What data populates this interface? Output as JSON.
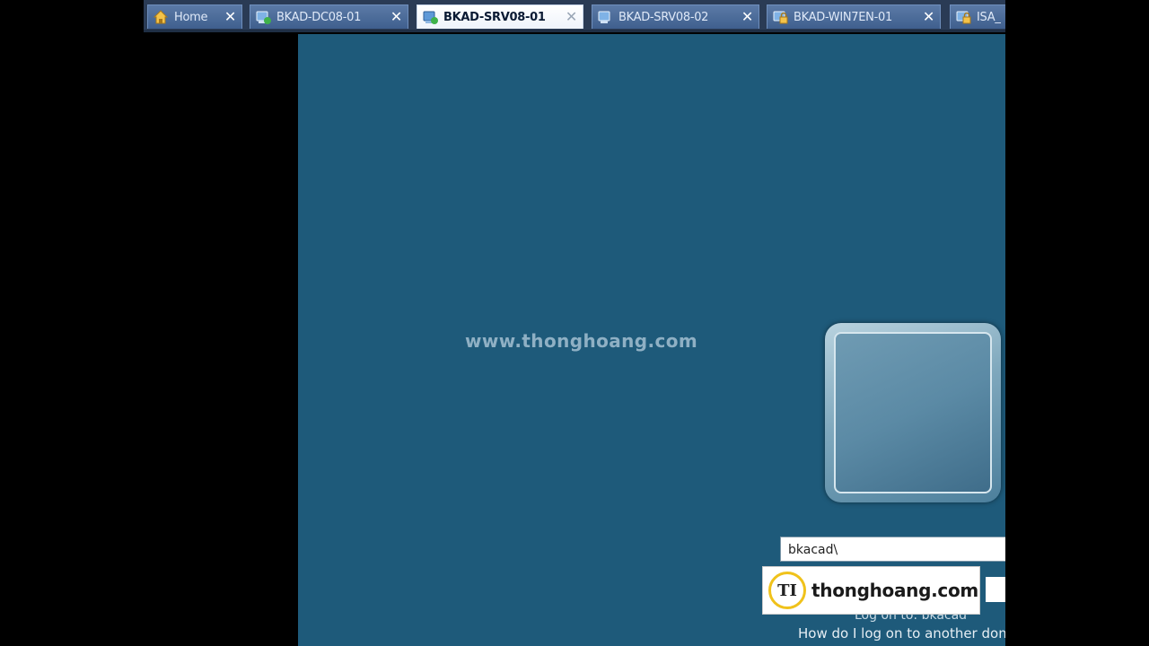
{
  "tabs": [
    {
      "label": "Home",
      "icon": "home-icon",
      "active": false
    },
    {
      "label": "BKAD-DC08-01",
      "icon": "vm-running-icon",
      "active": false
    },
    {
      "label": "BKAD-SRV08-01",
      "icon": "vm-running-icon",
      "active": true
    },
    {
      "label": "BKAD-SRV08-02",
      "icon": "vm-icon",
      "active": false
    },
    {
      "label": "BKAD-WIN7EN-01",
      "icon": "vm-locked-icon",
      "active": false
    },
    {
      "label": "ISA_",
      "icon": "vm-locked-icon",
      "active": false
    }
  ],
  "close_glyph": "✕",
  "console": {
    "watermark": "www.thonghoang.com",
    "username_value": "bkacad\\",
    "logon_to_text": "Log on to: bkacad",
    "help_link": "How do I log on to another dom"
  },
  "logo": {
    "monogram": "TI",
    "text": "thonghoang.com",
    "ring_color": "#f0c21b"
  },
  "colors": {
    "console_bg": "#1e5a7a",
    "tabbar_bg": "#2a3b55"
  }
}
